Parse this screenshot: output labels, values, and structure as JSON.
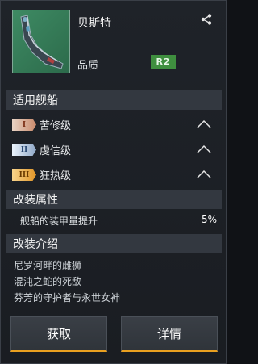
{
  "header": {
    "ship_name": "贝斯特",
    "quality_label": "品质",
    "quality_value": "R2"
  },
  "sections": {
    "ships_title": "适用舰船",
    "attributes_title": "改装属性",
    "intro_title": "改装介绍"
  },
  "ships": [
    {
      "tier": "I",
      "label": "苦修级"
    },
    {
      "tier": "II",
      "label": "虔信级"
    },
    {
      "tier": "III",
      "label": "狂热级"
    }
  ],
  "attribute": {
    "label": "舰船的装甲量提升",
    "value": "5%"
  },
  "intro_lines": [
    "尼罗河畔的雌狮",
    "混沌之蛇的死敌",
    "芬芳的守护者与永世女神"
  ],
  "buttons": {
    "obtain": "获取",
    "details": "详情"
  },
  "icons": {
    "share": "share-icon",
    "collapse": "chevron-up-icon"
  }
}
